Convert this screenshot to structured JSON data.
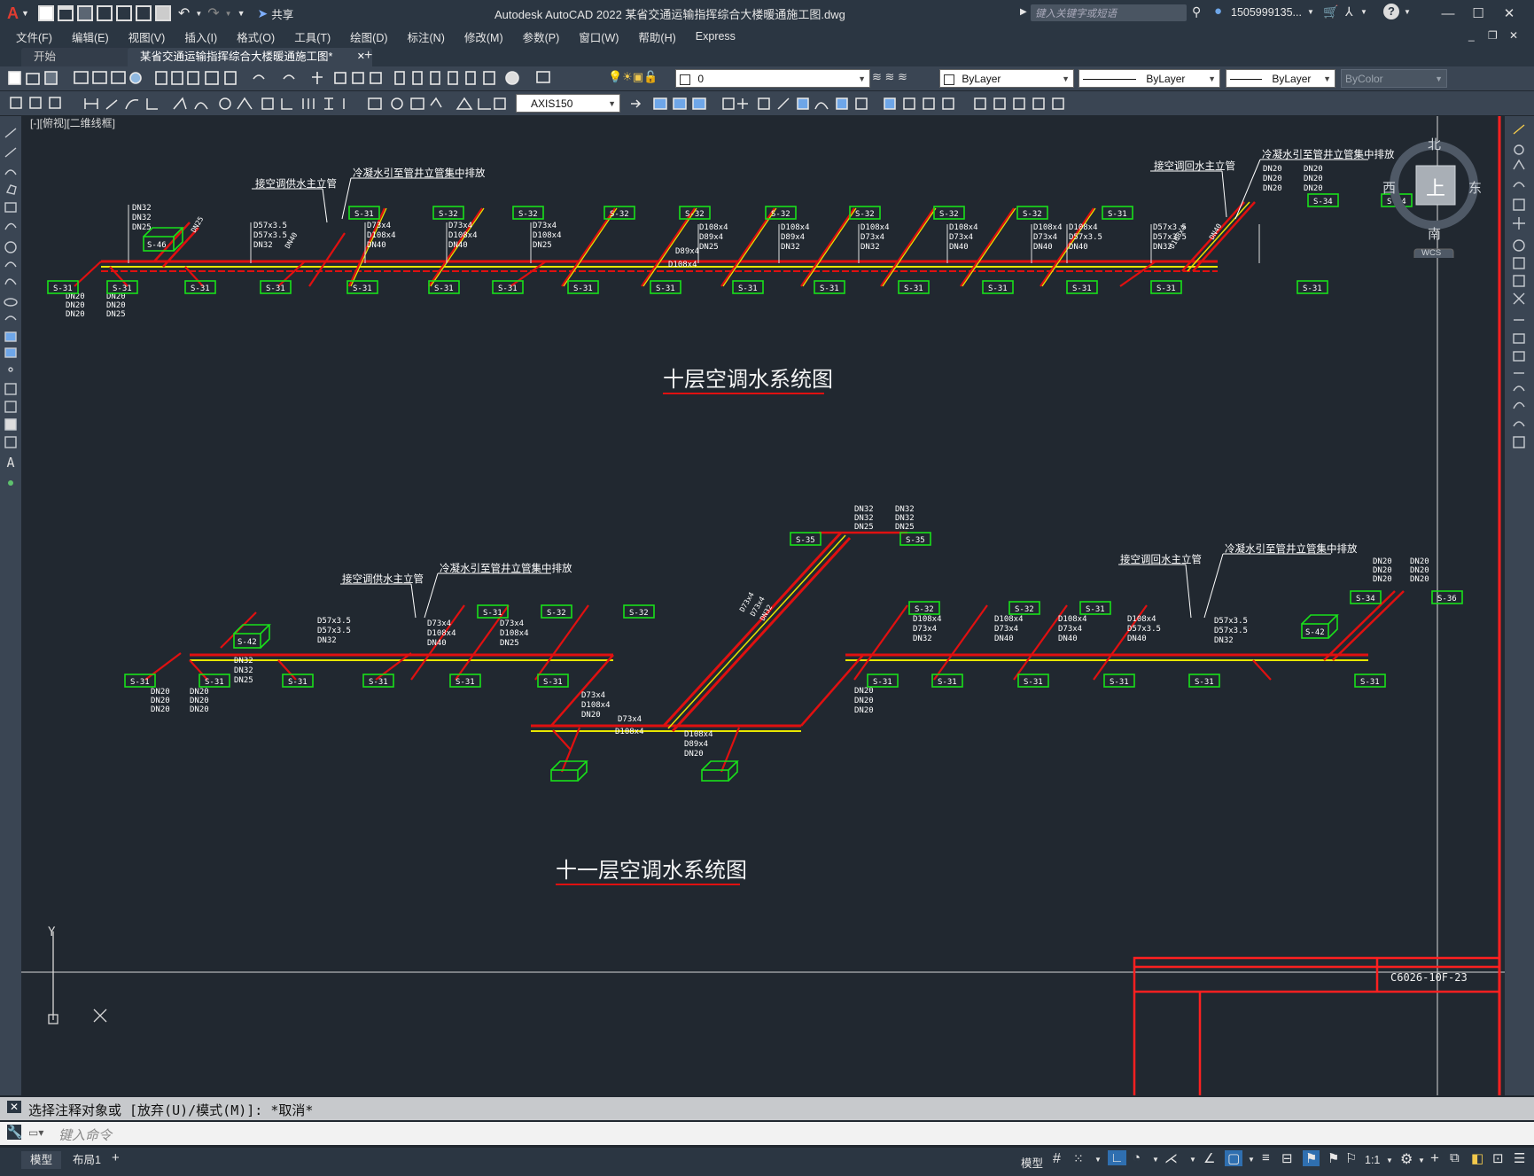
{
  "app": {
    "title": "Autodesk AutoCAD 2022    某省交通运输指挥综合大楼暖通施工图.dwg",
    "logo_letter": "A",
    "share_label": "共享",
    "search_placeholder": "键入关键字或短语",
    "user": "1505999135...",
    "help_icon": "?"
  },
  "menu": [
    "文件(F)",
    "编辑(E)",
    "视图(V)",
    "插入(I)",
    "格式(O)",
    "工具(T)",
    "绘图(D)",
    "标注(N)",
    "修改(M)",
    "参数(P)",
    "窗口(W)",
    "帮助(H)",
    "Express"
  ],
  "tabs": {
    "start": "开始",
    "drawing": "某省交通运输指挥综合大楼暖通施工图*",
    "new": "+"
  },
  "toolbar": {
    "layer_value": "0",
    "color_value": "ByLayer",
    "linetype_value": "ByLayer",
    "lineweight_value": "ByLayer",
    "plotstyle_value": "ByColor",
    "dimstyle_value": "AXIS150"
  },
  "viewport_label": "[-][俯视][二维线框]",
  "viewcube": {
    "north": "北",
    "south": "南",
    "east": "东",
    "west": "西",
    "face": "上",
    "wcs": "WCS"
  },
  "drawing": {
    "title_10": "十层空调水系统图",
    "title_11": "十一层空调水系统图",
    "ann_supply_10": "接空调供水主立管",
    "ann_cond_10a": "冷凝水引至管井立管集中排放",
    "ann_return_10": "接空调回水主立管",
    "ann_cond_10b": "冷凝水引至管井立管集中排放",
    "ann_supply_11": "接空调供水主立管",
    "ann_cond_11a": "冷凝水引至管井立管集中排放",
    "ann_return_11": "接空调回水主立管",
    "ann_cond_11b": "冷凝水引至管井立管集中排放",
    "pipe_main_10": "D108x4",
    "pipe_main_10b": "D89x4",
    "pipe_main_11": "D73x4",
    "pipe_main_11b": "D108x4",
    "drawing_no": "C6026-10F-23",
    "ucs_y": "Y",
    "ucs_x": "X",
    "units_row1": [
      "S-31",
      "S-31",
      "S-31",
      "S-31",
      "S-31",
      "S-31",
      "S-31",
      "S-31",
      "S-31",
      "S-31",
      "S-31",
      "S-31",
      "S-31",
      "S-31",
      "S-31",
      "S-31"
    ],
    "units_row1_top": [
      "S-31",
      "S-32",
      "S-32",
      "S-32",
      "S-32",
      "S-32",
      "S-32",
      "S-32",
      "S-32",
      "S-31"
    ],
    "special_units": {
      "s46": "S-46",
      "s34a": "S-34",
      "s34b": "S-34",
      "s35a": "S-35",
      "s35b": "S-35",
      "s42a": "S-42",
      "s42b": "S-42",
      "s36": "S-36",
      "s34c": "S-34"
    },
    "dn_labels": {
      "a": "DN32",
      "b": "DN32",
      "c": "DN25",
      "d": "DN20",
      "e": "DN20",
      "f": "DN20"
    },
    "size_labels": [
      "D57x3.5",
      "D57x3.5",
      "DN32",
      "D73x4",
      "D108x4",
      "DN40",
      "D108x4",
      "D89x4",
      "DN25",
      "D108x4",
      "D73x4",
      "DN32"
    ]
  },
  "command": {
    "history": "选择注释对象或 [放弃(U)/模式(M)]: *取消*",
    "input_placeholder": "键入命令"
  },
  "status": {
    "layout_model": "模型",
    "layout_1": "布局1",
    "add": "+",
    "model_label": "模型",
    "scale": "1:1"
  }
}
